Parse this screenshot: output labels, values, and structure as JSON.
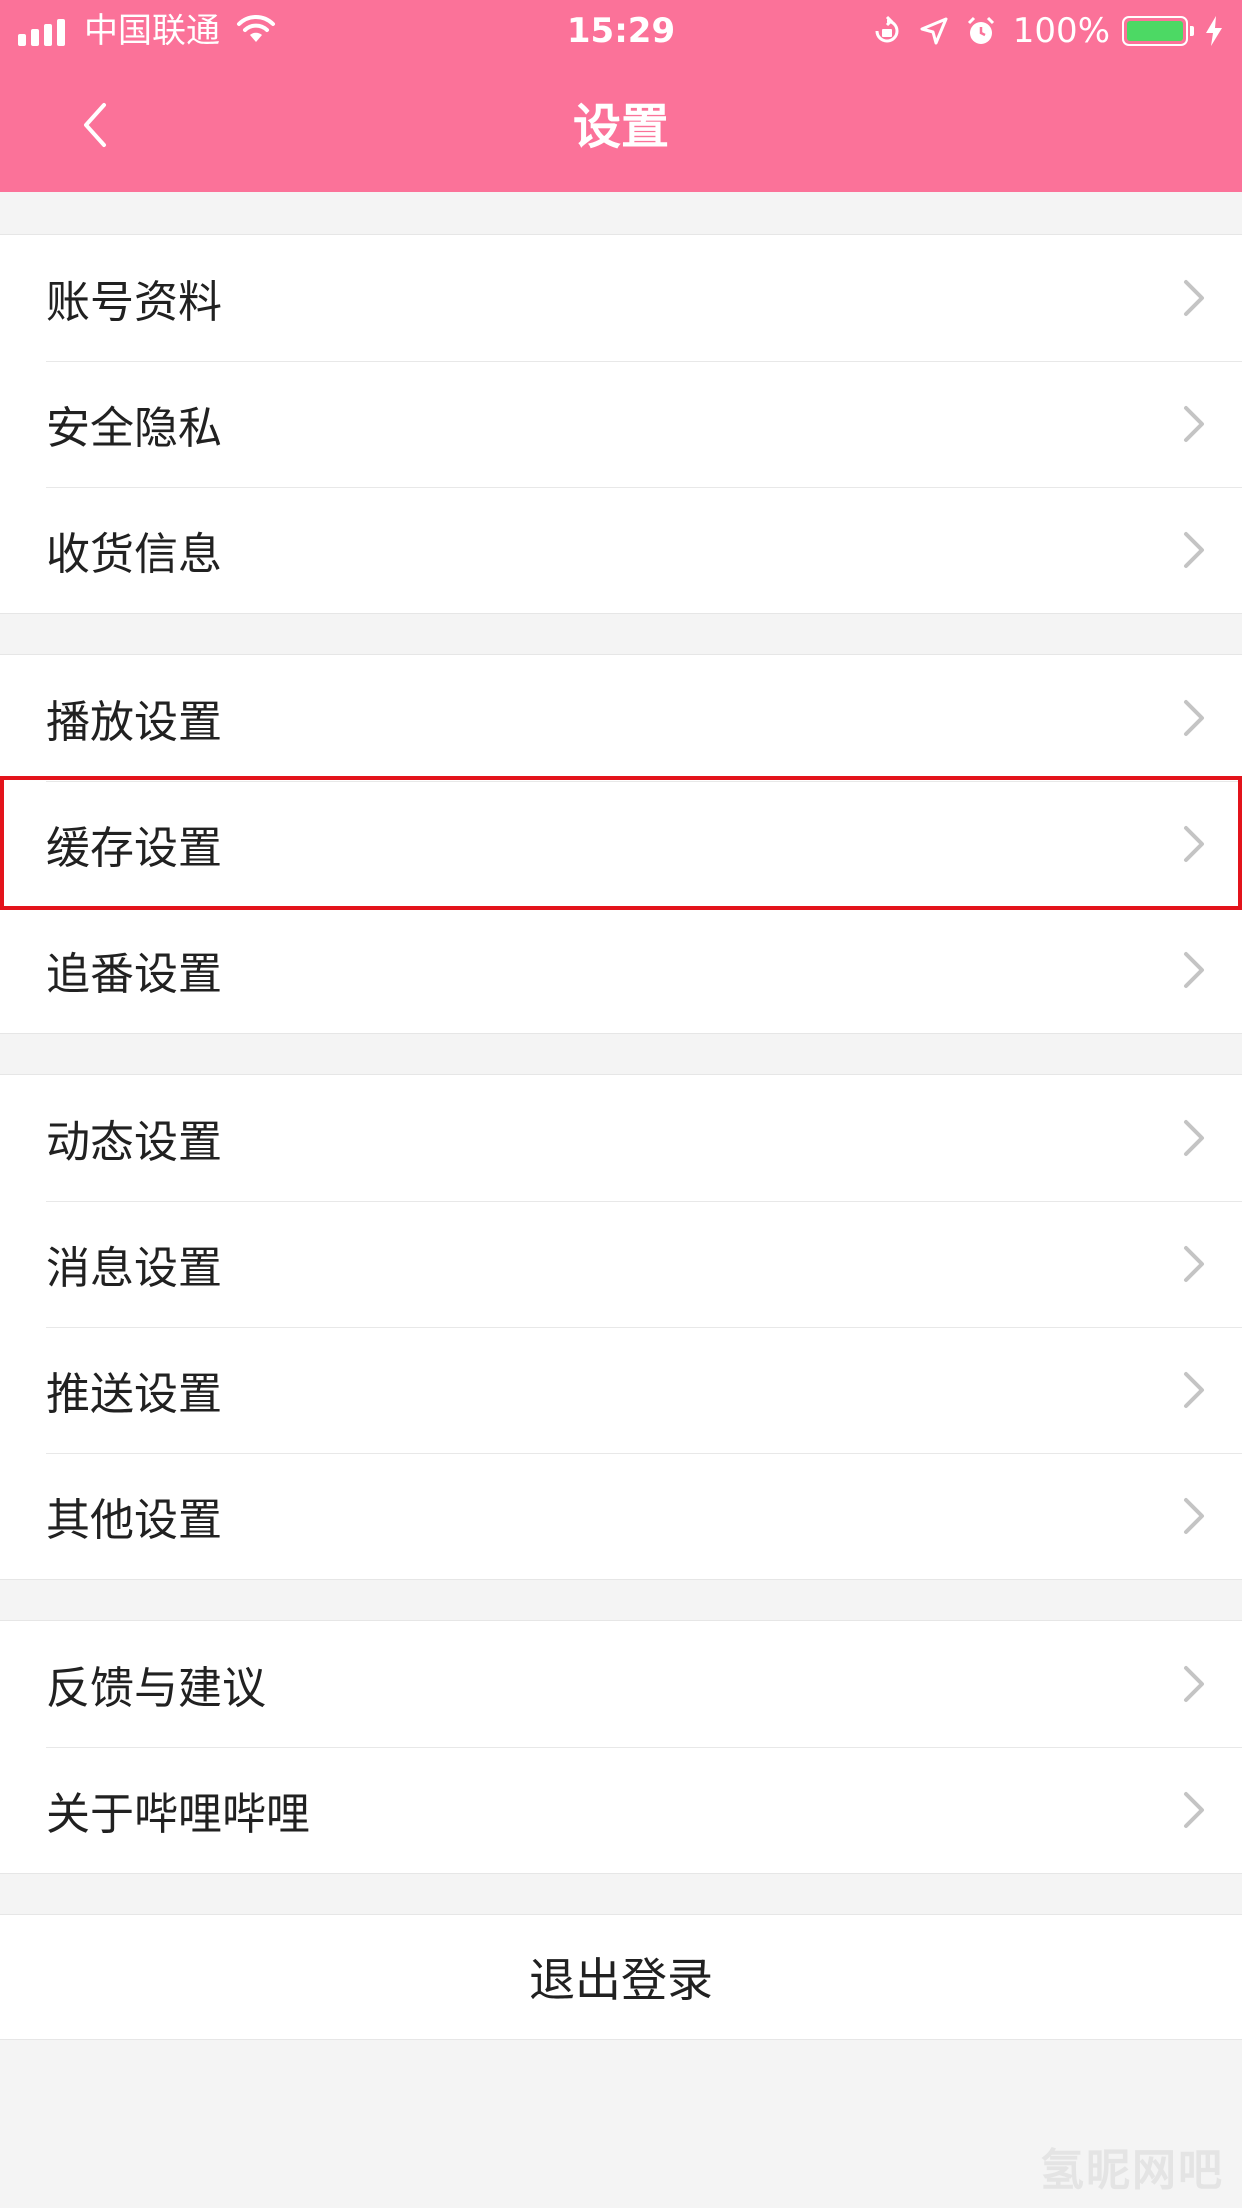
{
  "status_bar": {
    "carrier": "中国联通",
    "time": "15:29",
    "battery": "100%",
    "battery_level": 1.0,
    "battery_color": "#4cd964"
  },
  "theme": {
    "header_color": "#fb7299",
    "highlight_color": "#e3131b"
  },
  "nav": {
    "title": "设置",
    "back_icon": "chevron-left-icon"
  },
  "groups": [
    {
      "items": [
        "账号资料",
        "安全隐私",
        "收货信息"
      ]
    },
    {
      "items": [
        "播放设置",
        "缓存设置",
        "追番设置"
      ]
    },
    {
      "items": [
        "动态设置",
        "消息设置",
        "推送设置",
        "其他设置"
      ]
    },
    {
      "items": [
        "反馈与建议",
        "关于哔哩哔哩"
      ]
    }
  ],
  "logout_label": "退出登录",
  "watermark": "氢昵网吧"
}
